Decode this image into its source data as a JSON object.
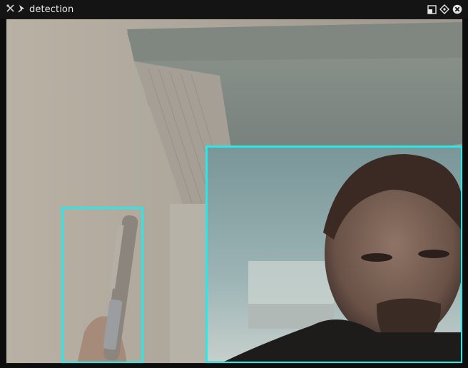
{
  "window": {
    "title": "detection",
    "title_icons": [
      "tools-icon",
      "pin-icon"
    ],
    "controls": [
      "restore-icon",
      "move-icon",
      "close-icon"
    ]
  },
  "detections": [
    {
      "name": "pen-detection-box"
    },
    {
      "name": "face-detection-box"
    }
  ],
  "colors": {
    "box": "#28e8e8",
    "titlebar": "#141414"
  }
}
